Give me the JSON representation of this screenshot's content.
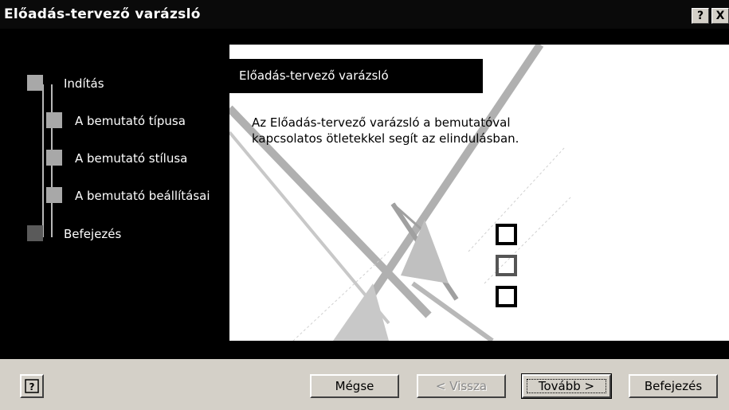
{
  "window": {
    "title": "Előadás-tervező varázsló",
    "help_glyph": "?",
    "close_glyph": "X"
  },
  "steps": [
    {
      "label": "Indítás",
      "status": "done"
    },
    {
      "label": "A bemutató típusa",
      "status": "pending"
    },
    {
      "label": "A bemutató stílusa",
      "status": "pending"
    },
    {
      "label": "A bemutató beállításai",
      "status": "pending"
    },
    {
      "label": "Befejezés",
      "status": "pending"
    }
  ],
  "panel": {
    "header": "Előadás-tervező varázsló",
    "description_line1": "Az Előadás-tervező varázsló a bemutatóval",
    "description_line2": "kapcsolatos ötletekkel segít az elindulásban."
  },
  "buttons": {
    "help_icon": "help-icon",
    "cancel": "Mégse",
    "back": "< Vissza",
    "next": "Tovább >",
    "finish": "Befejezés"
  }
}
